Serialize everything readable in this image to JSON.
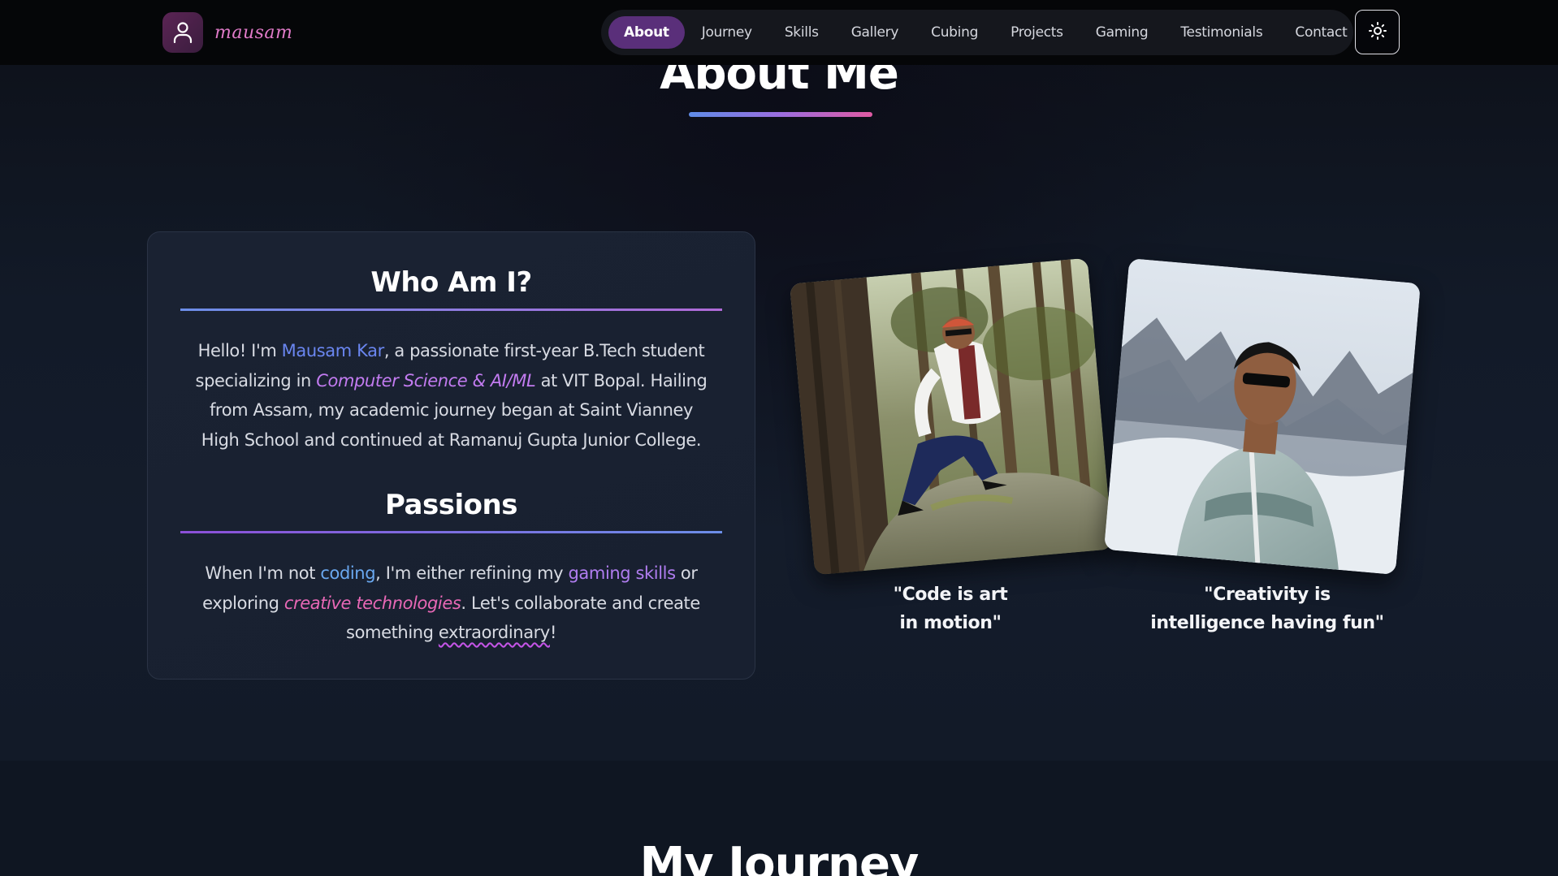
{
  "nav": {
    "brand_name": "mausam",
    "brand_icon": "user-icon",
    "items": [
      {
        "label": "About",
        "active": true
      },
      {
        "label": "Journey",
        "active": false
      },
      {
        "label": "Skills",
        "active": false
      },
      {
        "label": "Gallery",
        "active": false
      },
      {
        "label": "Cubing",
        "active": false
      },
      {
        "label": "Projects",
        "active": false
      },
      {
        "label": "Gaming",
        "active": false
      },
      {
        "label": "Testimonials",
        "active": false
      },
      {
        "label": "Contact",
        "active": false
      }
    ],
    "theme_toggle_icon": "sun-icon",
    "active_color": "#5a2f7a"
  },
  "about": {
    "title": "About Me",
    "who": {
      "heading": "Who Am I?",
      "p1": "Hello! I'm ",
      "name": "Mausam Kar",
      "p2": ", a passionate first-year B.Tech student specializing in ",
      "field": "Computer Science & AI/ML",
      "p3": " at VIT Bopal. Hailing from Assam, my academic journey began at Saint Vianney High School and continued at Ramanuj Gupta Junior College."
    },
    "passions": {
      "heading": "Passions",
      "p1": "When I'm not ",
      "coding": "coding",
      "p2": ", I'm either refining my ",
      "gaming": "gaming skills",
      "p3": " or exploring ",
      "creative": "creative technologies",
      "p4": ". Let's collaborate and create something ",
      "extra": "extraordinary",
      "p5": "!"
    },
    "photos": [
      {
        "caption_line1": "\"Code is art",
        "caption_line2": "in motion\""
      },
      {
        "caption_line1": "\"Creativity is",
        "caption_line2": "intelligence having fun\""
      }
    ]
  },
  "next_section": {
    "title": "My Journey"
  },
  "colors": {
    "background": "#121a28",
    "accent_blue": "#6a86f0",
    "accent_violet": "#c27bf0",
    "accent_pink": "#e868b6"
  }
}
